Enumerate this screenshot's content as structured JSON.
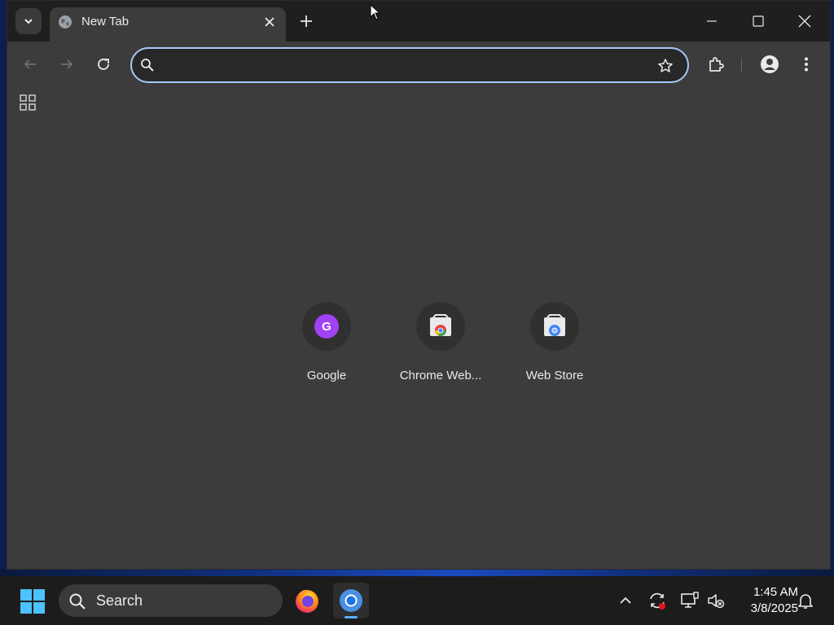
{
  "browser": {
    "tab": {
      "title": "New Tab"
    },
    "omnibox": {
      "value": "",
      "placeholder": ""
    },
    "shortcuts": [
      {
        "label": "Google",
        "icon": "google-letter-icon",
        "letter": "G"
      },
      {
        "label": "Chrome Web...",
        "icon": "chrome-web-store-icon"
      },
      {
        "label": "Web Store",
        "icon": "web-store-icon"
      }
    ]
  },
  "taskbar": {
    "search_label": "Search",
    "apps": [
      {
        "name": "firefox-icon"
      },
      {
        "name": "chrome-icon",
        "active": true
      }
    ],
    "clock": {
      "time": "1:45 AM",
      "date": "3/8/2025"
    }
  },
  "colors": {
    "page_bg": "#3c3c3c",
    "titlebar_bg": "#1f1f1f",
    "omnibox_border": "#a8c7fa",
    "taskbar_bg": "#1c1c1c",
    "accent": "#5ab0ff"
  }
}
